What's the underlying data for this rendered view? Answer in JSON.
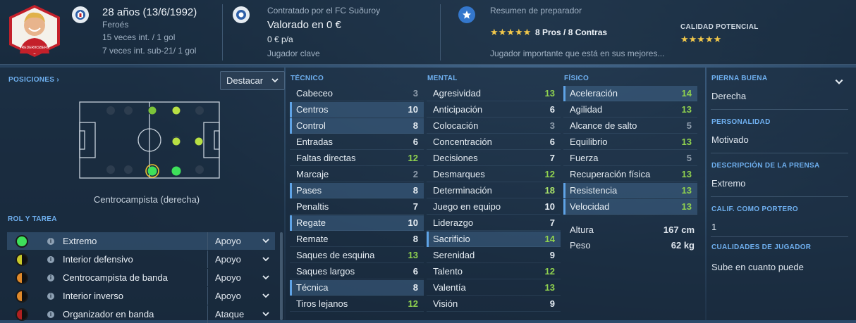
{
  "header": {
    "age": "28 años (13/6/1992)",
    "nation": "Feroés",
    "caps": "15 veces int. / 1 gol",
    "u21": "7 veces int. sub-21/ 1 gol",
    "contract_club": "Contratado por el FC Suðuroy",
    "value": "Valorado en 0 €",
    "wage": "0 € p/a",
    "squad_status": "Jugador clave",
    "scout_title": "Resumen de preparador",
    "scout_stars": "★★★★★",
    "scout_pros_cons": "8 Pros / 8 Contras",
    "scout_summary": "Jugador importante que está en sus mejores...",
    "potential_label": "CALIDAD POTENCIAL",
    "potential_stars": "★★★★★",
    "portrait_club_text": "FREDERIKSBERG"
  },
  "positions": {
    "label": "POSICIONES ›",
    "dropdown": "Destacar",
    "position_name": "Centrocampista (derecha)"
  },
  "roles": {
    "label": "ROL Y TAREA",
    "items": [
      {
        "name": "Extremo",
        "duty": "Apoyo",
        "color": "#3ee05a"
      },
      {
        "name": "Interior defensivo",
        "duty": "Apoyo",
        "color": "#c8c82a"
      },
      {
        "name": "Centrocampista de banda",
        "duty": "Apoyo",
        "color": "#e0892a"
      },
      {
        "name": "Interior inverso",
        "duty": "Apoyo",
        "color": "#e0892a"
      },
      {
        "name": "Organizador en banda",
        "duty": "Ataque",
        "color": "#b02020"
      }
    ]
  },
  "technical": {
    "label": "TÉCNICO",
    "items": [
      {
        "name": "Cabeceo",
        "value": "3"
      },
      {
        "name": "Centros",
        "value": "10"
      },
      {
        "name": "Control",
        "value": "8"
      },
      {
        "name": "Entradas",
        "value": "6"
      },
      {
        "name": "Faltas directas",
        "value": "12"
      },
      {
        "name": "Marcaje",
        "value": "2"
      },
      {
        "name": "Pases",
        "value": "8"
      },
      {
        "name": "Penaltis",
        "value": "7"
      },
      {
        "name": "Regate",
        "value": "10"
      },
      {
        "name": "Remate",
        "value": "8"
      },
      {
        "name": "Saques de esquina",
        "value": "13"
      },
      {
        "name": "Saques largos",
        "value": "6"
      },
      {
        "name": "Técnica",
        "value": "8"
      },
      {
        "name": "Tiros lejanos",
        "value": "12"
      }
    ]
  },
  "mental": {
    "label": "MENTAL",
    "items": [
      {
        "name": "Agresividad",
        "value": "13"
      },
      {
        "name": "Anticipación",
        "value": "6"
      },
      {
        "name": "Colocación",
        "value": "3"
      },
      {
        "name": "Concentración",
        "value": "6"
      },
      {
        "name": "Decisiones",
        "value": "7"
      },
      {
        "name": "Desmarques",
        "value": "12"
      },
      {
        "name": "Determinación",
        "value": "18"
      },
      {
        "name": "Juego en equipo",
        "value": "10"
      },
      {
        "name": "Liderazgo",
        "value": "7"
      },
      {
        "name": "Sacrificio",
        "value": "14"
      },
      {
        "name": "Serenidad",
        "value": "9"
      },
      {
        "name": "Talento",
        "value": "12"
      },
      {
        "name": "Valentía",
        "value": "13"
      },
      {
        "name": "Visión",
        "value": "9"
      }
    ]
  },
  "physical": {
    "label": "FÍSICO",
    "items": [
      {
        "name": "Aceleración",
        "value": "14"
      },
      {
        "name": "Agilidad",
        "value": "13"
      },
      {
        "name": "Alcance de salto",
        "value": "5"
      },
      {
        "name": "Equilibrio",
        "value": "13"
      },
      {
        "name": "Fuerza",
        "value": "5"
      },
      {
        "name": "Recuperación física",
        "value": "13"
      },
      {
        "name": "Resistencia",
        "value": "13"
      },
      {
        "name": "Velocidad",
        "value": "13"
      }
    ],
    "height_label": "Altura",
    "height": "167 cm",
    "weight_label": "Peso",
    "weight": "62 kg"
  },
  "info": {
    "foot_label": "PIERNA BUENA",
    "foot": "Derecha",
    "personality_label": "PERSONALIDAD",
    "personality": "Motivado",
    "press_label": "DESCRIPCIÓN DE LA PRENSA",
    "press": "Extremo",
    "gk_label": "CALIF. COMO PORTERO",
    "gk": "1",
    "traits_label": "CUALIDADES DE JUGADOR",
    "traits": "Sube en cuanto puede"
  }
}
